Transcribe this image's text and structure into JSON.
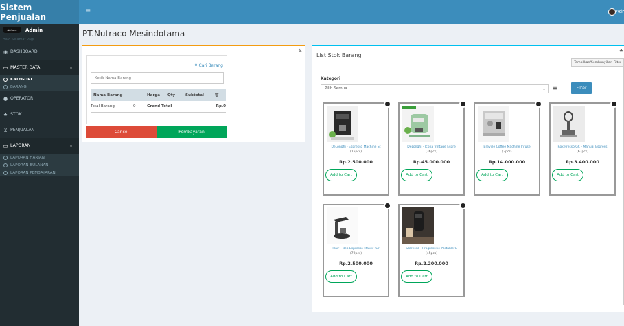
{
  "app": {
    "title": "Sistem Penjualan",
    "user": "Admin",
    "menu_icon": "hamburger-icon"
  },
  "sidebar": {
    "user_name": "Admin",
    "user_thumb_text": "Nutraco",
    "user_status": "Halo Selamat Pagi",
    "items": [
      {
        "label": "DASHBOARD",
        "icon": "dashboard-icon"
      },
      {
        "label": "MASTER DATA",
        "icon": "folder-icon"
      },
      {
        "label": "KATEGORI",
        "icon": "circle-icon"
      },
      {
        "label": "BARANG",
        "icon": "circle-icon"
      },
      {
        "label": "OPERATOR",
        "icon": "user-icon"
      },
      {
        "label": "STOK",
        "icon": "users-icon"
      },
      {
        "label": "PENJUALAN",
        "icon": "cart-icon"
      },
      {
        "label": "LAPORAN",
        "icon": "folder-icon"
      },
      {
        "label": "LAPORAN HARIAN",
        "icon": "circle-icon"
      },
      {
        "label": "LAPORAN BULANAN",
        "icon": "circle-icon"
      },
      {
        "label": "LAPORAN PEMBAYARAN",
        "icon": "circle-icon"
      }
    ]
  },
  "page": {
    "title": "PT.Nutraco Mesindotama"
  },
  "cart": {
    "search_button": "Cari Barang",
    "search_placeholder": "Ketik Nama Barang",
    "columns": [
      "Nama Barang",
      "Harga",
      "Qty",
      "Subtotal"
    ],
    "total_label": "Total Barang",
    "total_count": "0",
    "grand_total_label": "Grand Total",
    "grand_total_value": "Rp.0",
    "cancel_label": "Cancel",
    "pay_label": "Pembayaran"
  },
  "stock": {
    "title": "List Stok Barang",
    "toggle_filter": "Tampilkan/Sembunyikan Filter",
    "category_label": "Kategori",
    "category_value": "Pilih Semua",
    "filter_label": "Filter",
    "add_label": "Add to Cart",
    "products": [
      {
        "name": "DeLonghi - Espresso Machine St",
        "stock": "(15pcs)",
        "price": "Rp.2.500.000"
      },
      {
        "name": "DeLonghi - Icona Vintage Espre",
        "stock": "(36pcs)",
        "price": "Rp.45.000.000"
      },
      {
        "name": "Breville Coffee Machine Infuse",
        "stock": "(3pcs)",
        "price": "Rp.14.000.000"
      },
      {
        "name": "Rok Presso GC - Manual Espress",
        "stock": "(67pcs)",
        "price": "Rp.3.400.000"
      },
      {
        "name": "Flair - Neo Espresso Maker (Gr",
        "stock": "(79pcs)",
        "price": "Rp.2.500.000"
      },
      {
        "name": "Staresso - Progressive Portable C",
        "stock": "(45pcs)",
        "price": "Rp.2.200.000"
      }
    ]
  },
  "colors": {
    "header": "#3c8dbc",
    "logo": "#367fa9",
    "sidebar": "#222d32",
    "warning": "#f39c12",
    "info": "#00c0ef",
    "success": "#00a65a",
    "danger": "#dd4b39"
  }
}
